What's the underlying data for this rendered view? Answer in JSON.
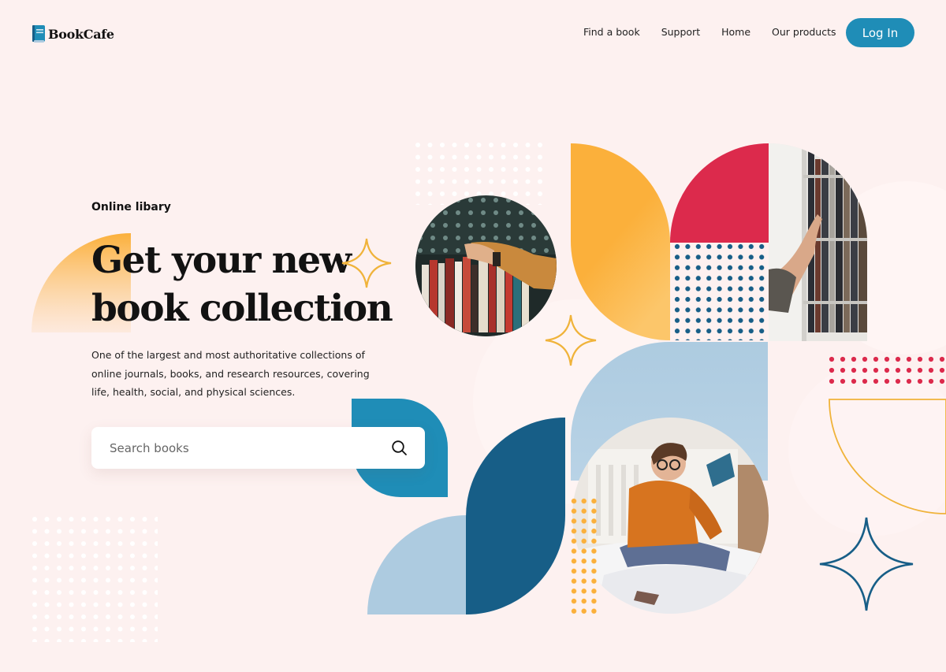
{
  "brand": {
    "name": "BookCafe"
  },
  "nav": {
    "items": [
      "Find a book",
      "Support",
      "Home",
      "Our products"
    ],
    "login_label": "Log In"
  },
  "hero": {
    "eyebrow": "Online libary",
    "headline_line1": "Get your new",
    "headline_line2": "book collection",
    "description": "One of the largest and most authoritative collections of online journals, books, and research resources, covering life, health, social, and physical sciences."
  },
  "search": {
    "placeholder": "Search books"
  },
  "colors": {
    "background": "#fdf1f0",
    "primary_blue": "#1f8db7",
    "dark_blue": "#175e87",
    "light_blue": "#adcbe0",
    "orange": "#fbb03b",
    "crimson": "#dc2a4c",
    "gold_line": "#f0b33a"
  },
  "icons": [
    "book-logo-icon",
    "search-icon",
    "sparkle-icon"
  ]
}
